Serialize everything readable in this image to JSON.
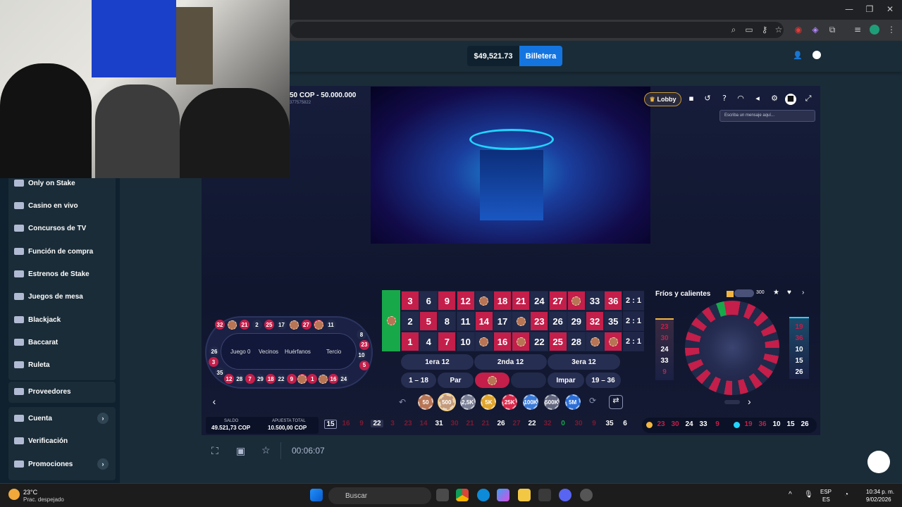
{
  "browser": {
    "window_controls": [
      "—",
      "❐",
      "✕"
    ]
  },
  "header": {
    "balance": "$49,521.73",
    "wallet_label": "Billetera"
  },
  "sidebar": {
    "items": [
      {
        "label": "Only on Stake"
      },
      {
        "label": "Casino en vivo"
      },
      {
        "label": "Concursos de TV"
      },
      {
        "label": "Función de compra"
      },
      {
        "label": "Estrenos de Stake"
      },
      {
        "label": "Juegos de mesa"
      },
      {
        "label": "Blackjack"
      },
      {
        "label": "Baccarat"
      },
      {
        "label": "Ruleta"
      }
    ],
    "providers": "Proveedores",
    "account": "Cuenta",
    "verification": "Verificación",
    "promotions": "Promociones"
  },
  "game": {
    "limits": "50 COP - 50.000.000",
    "game_id": "377575822",
    "lobby": "Lobby",
    "chat_placeholder": "Escriba un mensaje aquí...",
    "hot_cold_title": "Fríos y calientes",
    "hot_cold_count": "300",
    "grid": {
      "row_top": [
        "3",
        "6",
        "9",
        "12",
        "15",
        "18",
        "21",
        "24",
        "27",
        "30",
        "33",
        "36"
      ],
      "row_mid": [
        "2",
        "5",
        "8",
        "11",
        "14",
        "17",
        "20",
        "23",
        "26",
        "29",
        "32",
        "35"
      ],
      "row_bot": [
        "1",
        "4",
        "7",
        "10",
        "13",
        "16",
        "19",
        "22",
        "25",
        "28",
        "31",
        "34"
      ],
      "colors_top": [
        "red",
        "blk",
        "red",
        "red",
        "blk",
        "red",
        "red",
        "blk",
        "red",
        "red",
        "blk",
        "red"
      ],
      "colors_mid": [
        "blk",
        "red",
        "blk",
        "blk",
        "red",
        "blk",
        "blk",
        "red",
        "blk",
        "blk",
        "red",
        "blk"
      ],
      "colors_bot": [
        "red",
        "blk",
        "red",
        "blk",
        "blk",
        "red",
        "red",
        "blk",
        "red",
        "blk",
        "blk",
        "red"
      ],
      "chip_top": [
        false,
        false,
        false,
        false,
        true,
        false,
        false,
        false,
        false,
        true,
        false,
        false
      ],
      "chip_mid": [
        false,
        false,
        false,
        false,
        false,
        false,
        true,
        false,
        false,
        false,
        false,
        false
      ],
      "chip_bot": [
        false,
        false,
        false,
        false,
        true,
        false,
        true,
        false,
        false,
        false,
        true,
        true
      ],
      "col_labels": [
        "2 : 1",
        "2 : 1",
        "2 : 1"
      ],
      "dozens": [
        "1era 12",
        "2nda 12",
        "3era 12"
      ],
      "outside": [
        "1 – 18",
        "Par",
        "",
        "Impar",
        "19 – 36"
      ]
    },
    "racetrack": {
      "labels": [
        "Juego 0",
        "Vecinos",
        "Huérfanos",
        "Tercio"
      ],
      "top": [
        "32",
        "4",
        "21",
        "2",
        "25",
        "17",
        "6",
        "27",
        "36",
        "11"
      ],
      "top_chip": [
        false,
        true,
        false,
        false,
        false,
        false,
        true,
        false,
        true,
        false
      ],
      "bottom": [
        "12",
        "28",
        "7",
        "29",
        "18",
        "22",
        "9",
        "14",
        "1",
        "33",
        "16",
        "24"
      ],
      "bottom_chip": [
        false,
        false,
        false,
        false,
        false,
        false,
        false,
        true,
        false,
        true,
        false,
        false
      ],
      "left": [
        "26",
        "3",
        "35"
      ],
      "right": [
        "8",
        "23",
        "10",
        "5"
      ]
    },
    "chips": [
      "50",
      "500",
      "2,5K",
      "5K",
      "25K",
      "100K",
      "500K",
      "5M"
    ],
    "balance_label": "SALDO",
    "balance_value": "49.521,73 COP",
    "total_bet_label": "APUESTA TOTAL",
    "total_bet_value": "10.500,00 COP",
    "history": [
      "15",
      "16",
      "9",
      "22",
      "3",
      "23",
      "14",
      "31",
      "30",
      "21",
      "21",
      "26",
      "27",
      "22",
      "32",
      "0",
      "30",
      "9",
      "35",
      "6"
    ],
    "history_colors": [
      "blk",
      "red",
      "red",
      "blk",
      "red",
      "red",
      "red",
      "blk",
      "red",
      "red",
      "red",
      "blk",
      "red",
      "blk",
      "red",
      "grn",
      "red",
      "red",
      "blk",
      "blk"
    ],
    "cold_numbers": [
      "23",
      "30",
      "24",
      "33",
      "9"
    ],
    "hot_numbers": [
      "19",
      "36",
      "10",
      "15",
      "26"
    ],
    "timer": "00:06:07"
  },
  "taskbar": {
    "weather_temp": "23°C",
    "weather_desc": "Prac. despejado",
    "search": "Buscar",
    "lang": "ESP",
    "lang2": "ES",
    "time": "10:34 p. m.",
    "date": "9/02/2026"
  }
}
